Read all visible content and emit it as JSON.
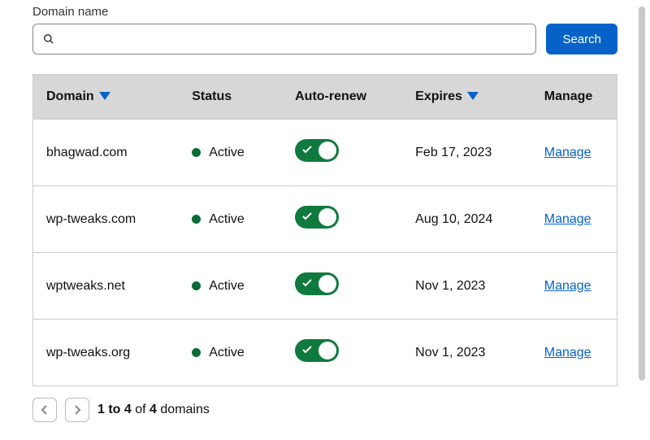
{
  "search": {
    "label": "Domain name",
    "button": "Search",
    "placeholder": ""
  },
  "columns": {
    "domain": "Domain",
    "status": "Status",
    "auto_renew": "Auto-renew",
    "expires": "Expires",
    "manage": "Manage"
  },
  "status_active": "Active",
  "manage_label": "Manage",
  "rows": [
    {
      "domain": "bhagwad.com",
      "status": "Active",
      "auto_renew": true,
      "expires": "Feb 17, 2023"
    },
    {
      "domain": "wp-tweaks.com",
      "status": "Active",
      "auto_renew": true,
      "expires": "Aug 10, 2024"
    },
    {
      "domain": "wptweaks.net",
      "status": "Active",
      "auto_renew": true,
      "expires": "Nov 1, 2023"
    },
    {
      "domain": "wp-tweaks.org",
      "status": "Active",
      "auto_renew": true,
      "expires": "Nov 1, 2023"
    }
  ],
  "pagination": {
    "range": "1 to 4",
    "of": "of",
    "total": "4",
    "unit": "domains"
  }
}
